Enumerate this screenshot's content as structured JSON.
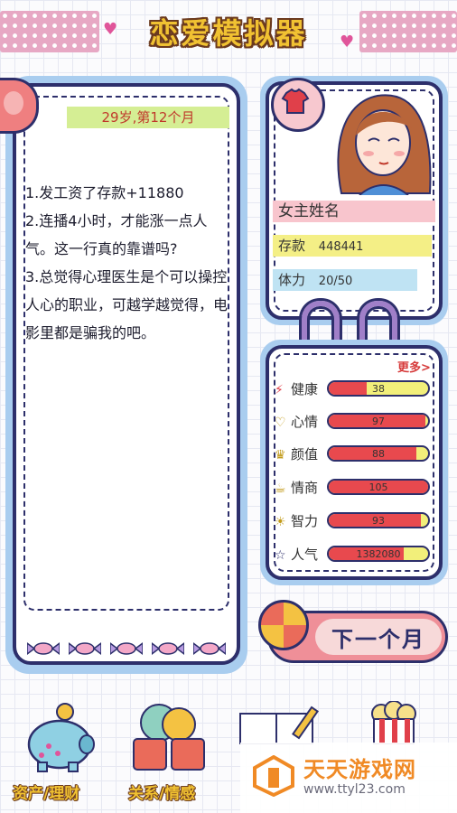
{
  "header": {
    "title": "恋爱模拟器"
  },
  "story": {
    "age_label": "29岁,第12个月",
    "events": [
      "1.发工资了存款+11880",
      "2.连播4小时，才能涨一点人气。这一行真的靠谱吗?",
      "3.总觉得心理医生是个可以操控人心的职业，可越学越觉得，电影里都是骗我的吧。"
    ]
  },
  "profile": {
    "name": "女主姓名",
    "savings_label": "存款",
    "savings_value": "448441",
    "stamina_label": "体力",
    "stamina_value": "20/50"
  },
  "stats": {
    "more_label": "更多>",
    "items": [
      {
        "icon": "lightning-icon",
        "label": "健康",
        "value": "38",
        "fill": 0.38
      },
      {
        "icon": "heart-icon",
        "label": "心情",
        "value": "97",
        "fill": 0.97
      },
      {
        "icon": "crown-icon",
        "label": "颜值",
        "value": "88",
        "fill": 0.88
      },
      {
        "icon": "coffee-icon",
        "label": "情商",
        "value": "105",
        "fill": 1.0
      },
      {
        "icon": "lightbulb-icon",
        "label": "智力",
        "value": "93",
        "fill": 0.93
      },
      {
        "icon": "star-icon",
        "label": "人气",
        "value": "1382080",
        "fill": 0.75
      }
    ]
  },
  "actions": {
    "next_month": "下一个月"
  },
  "bottom_nav": {
    "assets": "资产/理财",
    "relations": "关系/情感"
  },
  "watermark": {
    "name": "天天游戏网",
    "url": "www.ttyl23.com"
  },
  "colors": {
    "bar_fill": "#e8494e",
    "bar_track": "#f2ef7a",
    "frame": "#2d2f6b",
    "panel_blue": "#a9cdef"
  }
}
